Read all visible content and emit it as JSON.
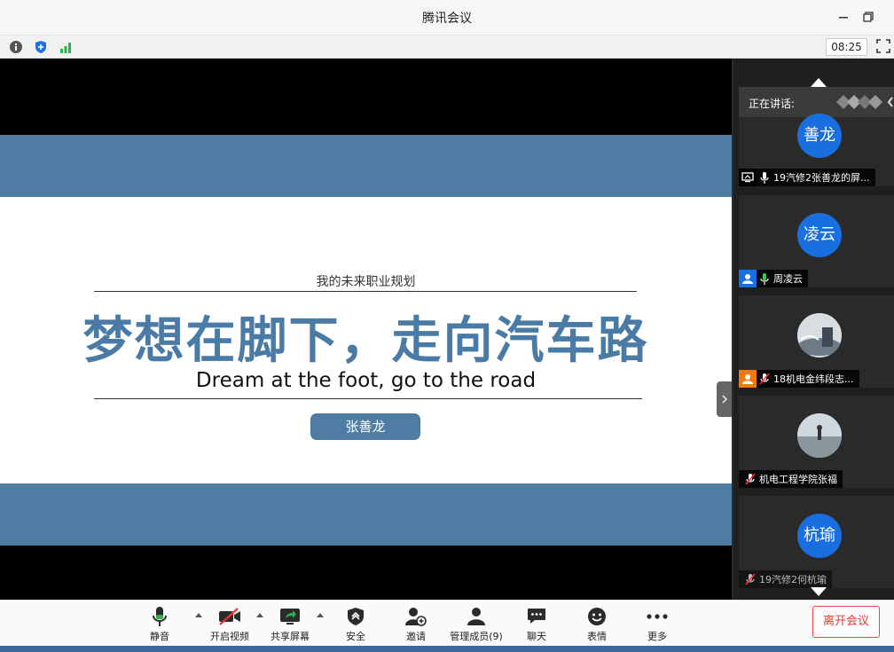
{
  "window": {
    "title": "腾讯会议",
    "minimize": "—",
    "restore": "❐"
  },
  "status": {
    "clock": "08:25"
  },
  "slide": {
    "subtitle": "我的未来职业规划",
    "title": "梦想在脚下，走向汽车路",
    "english": "Dream at the foot, go to the road",
    "presenter": "张善龙"
  },
  "sidebar": {
    "speaking_label": "正在讲话:",
    "participants": [
      {
        "avatar_text": "善龙",
        "name": "19汽修2张善龙的屏...",
        "badge": "screen-share-icon",
        "mic": "unmuted"
      },
      {
        "avatar_text": "凌云",
        "name": "周凌云",
        "badge": "user-icon",
        "mic": "active"
      },
      {
        "avatar_text": "",
        "name": "18机电金纬段志...",
        "badge": "user-icon",
        "mic": "muted"
      },
      {
        "avatar_text": "",
        "name": "机电工程学院张福",
        "badge": "",
        "mic": "muted"
      },
      {
        "avatar_text": "杭瑜",
        "name": "19汽修2何杭瑜",
        "badge": "",
        "mic": "muted"
      }
    ]
  },
  "toolbar": {
    "mute": "静音",
    "video": "开启视频",
    "share": "共享屏幕",
    "security": "安全",
    "invite": "邀请",
    "members": "管理成员(9)",
    "chat": "聊天",
    "reactions": "表情",
    "more": "更多",
    "leave": "离开会议"
  },
  "colors": {
    "slide_band": "#4e7ca3",
    "title_blue": "#4a7ba6",
    "avatar_blue": "#1a6fe0",
    "leave_red": "#e33333"
  }
}
